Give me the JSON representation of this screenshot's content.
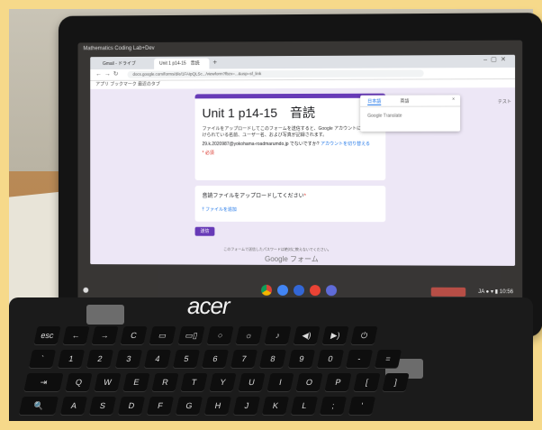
{
  "desktop": {
    "title": "Mathematics Coding Lab+Dev"
  },
  "browser": {
    "tabs": [
      {
        "label": "Gmail - ドライブ"
      },
      {
        "label": "Unit 1 p14-15　音読"
      }
    ],
    "address": "docs.google.com/forms/d/e/1FAIpQLSc.../viewform?fbzx=...&usp=sf_link",
    "bookmarks": "アプリ  ブックマーク  最近のタブ"
  },
  "form": {
    "title": "Unit 1 p14-15　音読",
    "description": "ファイルをアップロードしてこのフォームを送信すると、Google アカウントに関連付けられている名前、ユーザー名、および写真が記録されます。",
    "account": "29.k.2020987@yokohama-roadmarumdo.jp でないですか?",
    "account_switch": "アカウントを切り替える",
    "required_note": "* 必須",
    "upload_label": "音読ファイルをアップロードしてください",
    "upload_required_mark": "*",
    "upload_button": "ファイルを追加",
    "submit": "送信",
    "footer_note": "このフォームで送信したパスワードは絶対に教えないでください。",
    "brand": "Google フォーム"
  },
  "language_menu": {
    "tab_ja": "日本語",
    "tab_en": "英語",
    "close": "×",
    "caption": "Google Translate"
  },
  "side_text": "テスト",
  "shelf": {
    "status": "JA ● ▾ ▮ 10:56"
  },
  "laptop": {
    "brand": "acer"
  },
  "keyboard": {
    "row1": [
      "esc",
      "←",
      "→",
      "C",
      "▭",
      "▭▯",
      "○",
      "☼",
      "♪",
      "◀)",
      "▶)",
      "⏻"
    ],
    "row2": [
      "`",
      "1",
      "2",
      "3",
      "4",
      "5",
      "6",
      "7",
      "8",
      "9",
      "0",
      "-",
      "="
    ],
    "row3": [
      "⇥",
      "Q",
      "W",
      "E",
      "R",
      "T",
      "Y",
      "U",
      "I",
      "O",
      "P",
      "[",
      "]"
    ],
    "row4": [
      "🔍",
      "A",
      "S",
      "D",
      "F",
      "G",
      "H",
      "J",
      "K",
      "L",
      ";",
      "'"
    ]
  },
  "colors": {
    "form_accent": "#673ab7",
    "link": "#1a73e8",
    "required": "#d93025"
  }
}
